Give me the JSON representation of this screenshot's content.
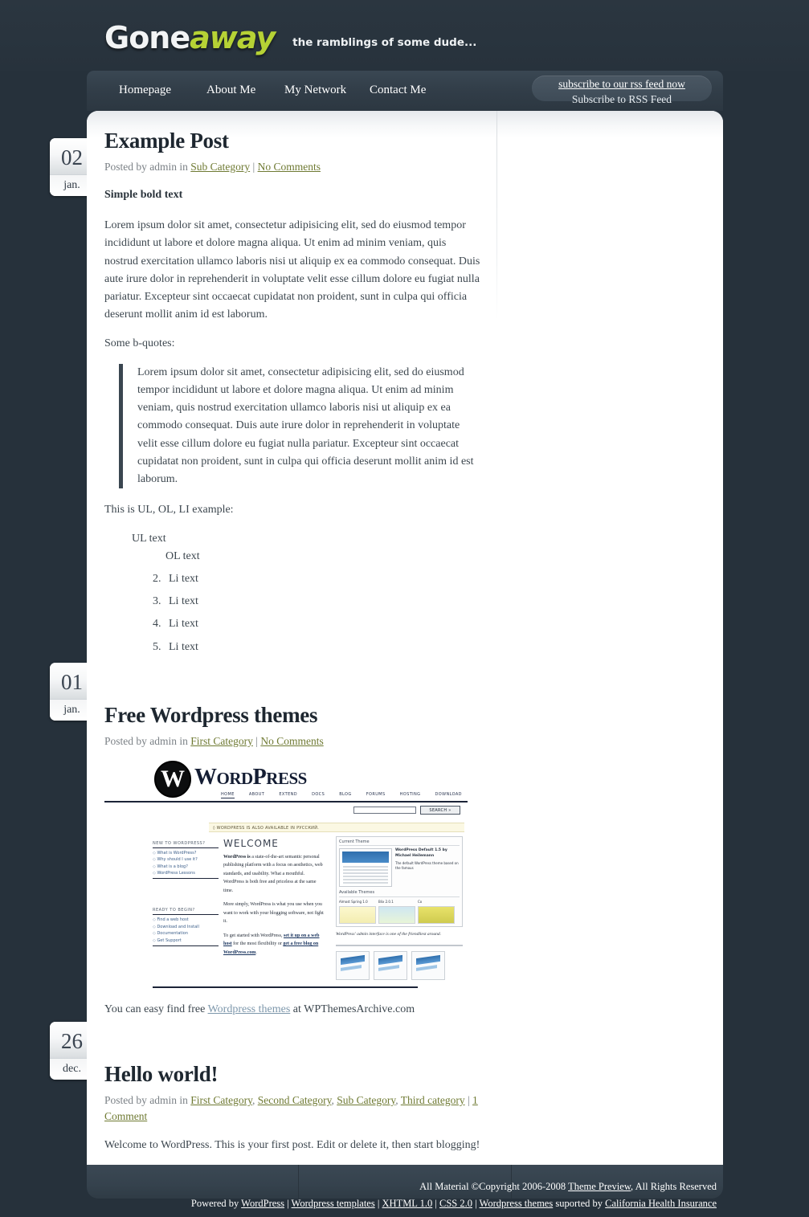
{
  "site": {
    "logo_part1": "Gone",
    "logo_part2": "away",
    "tagline": "the ramblings of some dude...",
    "logo_accent_color": "#b6d235",
    "background_color": "#26313b"
  },
  "nav": {
    "items": [
      {
        "label": "Homepage"
      },
      {
        "label": "About Me"
      },
      {
        "label": "My Network"
      },
      {
        "label": "Contact Me"
      }
    ],
    "rss": {
      "link_label": "subscribe to our rss feed now",
      "sub_label": "Subscribe to RSS Feed"
    }
  },
  "posts": [
    {
      "date": {
        "day": "02",
        "month": "jan."
      },
      "title": "Example Post",
      "meta_prefix": "Posted by admin in ",
      "categories": [
        "Sub Category"
      ],
      "comments": "No Comments",
      "bold_line": "Simple bold text",
      "paragraph1": "Lorem ipsum dolor sit amet, consectetur adipisicing elit, sed do eiusmod tempor incididunt ut labore et dolore magna aliqua. Ut enim ad minim veniam, quis nostrud exercitation ullamco laboris nisi ut aliquip ex ea commodo consequat. Duis aute irure dolor in reprehenderit in voluptate velit esse cillum dolore eu fugiat nulla pariatur. Excepteur sint occaecat cupidatat non proident, sunt in culpa qui officia deserunt mollit anim id est laborum.",
      "quote_intro": "Some b-quotes:",
      "blockquote": "Lorem ipsum dolor sit amet, consectetur adipisicing elit, sed do eiusmod tempor incididunt ut labore et dolore magna aliqua. Ut enim ad minim veniam, quis nostrud exercitation ullamco laboris nisi ut aliquip ex ea commodo consequat. Duis aute irure dolor in reprehenderit in voluptate velit esse cillum dolore eu fugiat nulla pariatur. Excepteur sint occaecat cupidatat non proident, sunt in culpa qui officia deserunt mollit anim id est laborum.",
      "list_intro": "This is UL, OL, LI example:",
      "ul_text": "UL text",
      "ol_text": "OL text",
      "li_items": [
        "Li text",
        "Li text",
        "Li text",
        "Li text"
      ]
    },
    {
      "date": {
        "day": "01",
        "month": "jan."
      },
      "title": "Free Wordpress themes",
      "meta_prefix": "Posted by admin in ",
      "categories": [
        "First Category"
      ],
      "comments": "No Comments",
      "closing_before": "You can easy find free ",
      "closing_link": "Wordpress themes",
      "closing_after": " at WPThemesArchive.com"
    },
    {
      "date": {
        "day": "26",
        "month": "dec."
      },
      "title": "Hello world!",
      "meta_prefix": "Posted by admin in ",
      "categories": [
        "First Category",
        "Second Category",
        "Sub Category",
        "Third category"
      ],
      "comments": "1 Comment",
      "paragraph1": "Welcome to WordPress. This is your first post. Edit or delete it, then start blogging!"
    }
  ],
  "wp_screenshot": {
    "wordmark_big": "W",
    "wordmark_rest": "ORD",
    "wordmark_p": "P",
    "wordmark_ress": "RESS",
    "nav": [
      "HOME",
      "ABOUT",
      "EXTEND",
      "DOCS",
      "BLOG",
      "FORUMS",
      "HOSTING",
      "DOWNLOAD"
    ],
    "search_button": "SEARCH »",
    "notice": "◊ WORDPRESS IS ALSO AVAILABLE IN РУССКИЙ.",
    "col1_head": "NEW TO WORDPRESS?",
    "col1_items": [
      "What is WordPress?",
      "Why should I use it?",
      "What is a blog?",
      "WordPress Lessons"
    ],
    "col2_head": "READY TO BEGIN?",
    "col2_items": [
      "Find a web host",
      "Download and Install",
      "Documentation",
      "Get Support"
    ],
    "welcome": "WELCOME",
    "p1_bold": "WordPress is",
    "p1_rest": " a state-of-the-art semantic personal publishing platform with a focus on aesthetics, web standards, and usability. What a mouthful. WordPress is both free and priceless at the same time.",
    "p2": "More simply, WordPress is what you use when you want to work with your blogging software, not fight it.",
    "p3_a": "To get started with WordPress, ",
    "p3_lk1": "set it up on a web host",
    "p3_b": " for the most flexibility or ",
    "p3_lk2": "get a free blog on WordPress.com",
    "p3_c": ".",
    "panel_title1": "Current Theme",
    "theme_name": "WordPress Default 1.5 by Michael Heilemann",
    "theme_desc": "The default WordPress theme based on the famous",
    "panel_title2": "Available Themes",
    "avail_names": [
      "Almost Spring 1.0",
      "Blix 2.0.1",
      "Co"
    ],
    "caption": "WordPress' admin interface is one of the friendliest around."
  },
  "footer": {
    "line1_a": "All Material ©Copyright 2006-2008 ",
    "line1_link": "Theme Preview",
    "line1_b": ", All Rights Reserved",
    "line2_a": "Powered by ",
    "line2_link1": "WordPress",
    "line2_sep1": " | ",
    "line2_link2": "Wordpress templates",
    "line2_sep2": " | ",
    "line2_link3": "XHTML 1.0",
    "line2_sep3": " | ",
    "line2_link4": "CSS 2.0",
    "line2_sep4": " | ",
    "line2_link5": "Wordpress themes",
    "line2_mid": " suported by ",
    "line2_link6": "California Health Insurance"
  }
}
